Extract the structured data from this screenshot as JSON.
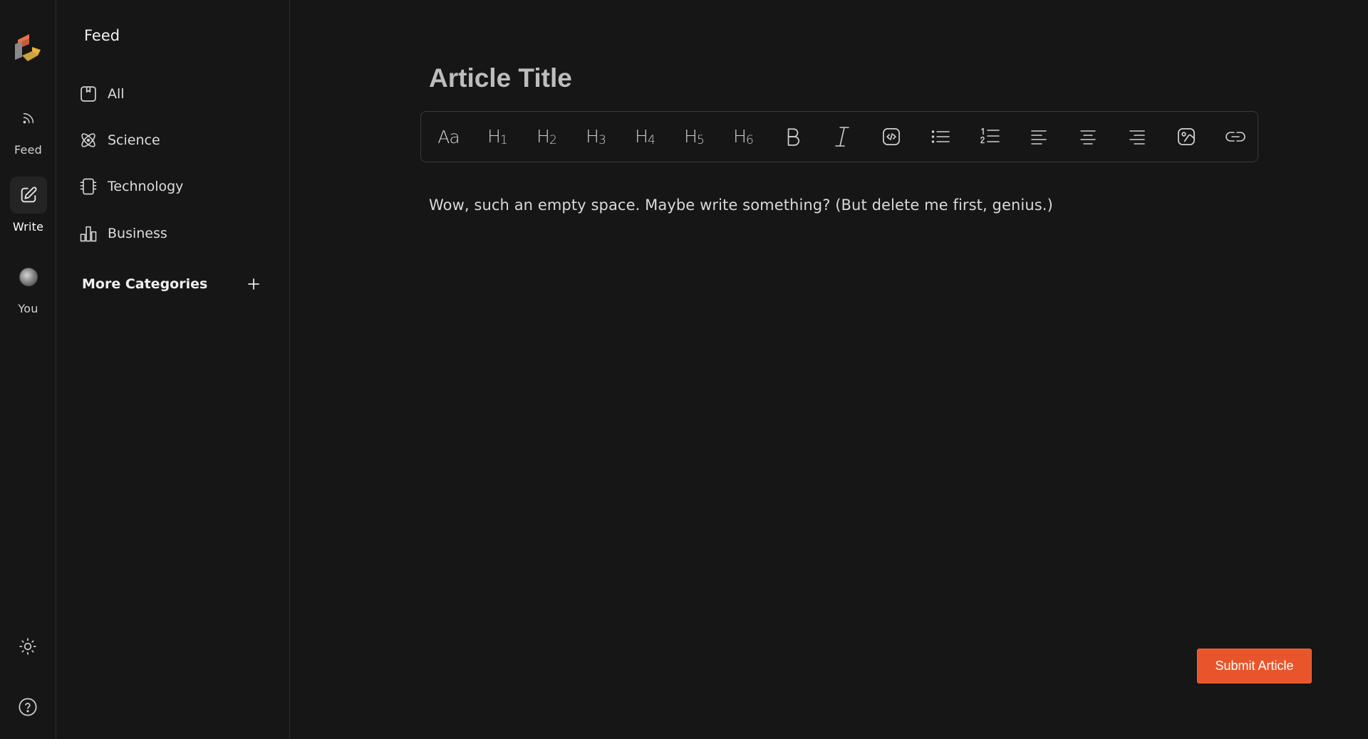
{
  "rail": {
    "logo_icon": "brand-logo-icon",
    "items": [
      {
        "label": "Feed",
        "icon": "rss-icon"
      },
      {
        "label": "Write",
        "icon": "edit-icon"
      },
      {
        "label": "You",
        "icon": "avatar"
      }
    ],
    "bottom": [
      {
        "icon": "sun-icon"
      },
      {
        "icon": "help-icon"
      }
    ]
  },
  "sidebar": {
    "title": "Feed",
    "categories": [
      {
        "label": "All",
        "icon": "bookmark-card-icon"
      },
      {
        "label": "Science",
        "icon": "atom-icon"
      },
      {
        "label": "Technology",
        "icon": "chip-icon"
      },
      {
        "label": "Business",
        "icon": "bar-chart-icon"
      }
    ],
    "more_label": "More Categories",
    "more_icon": "plus-icon"
  },
  "editor": {
    "title_placeholder": "Article Title",
    "toolbar": {
      "paragraph": "Aa",
      "h1": "H",
      "h1_sub": "1",
      "h2": "H",
      "h2_sub": "2",
      "h3": "H",
      "h3_sub": "3",
      "h4": "H",
      "h4_sub": "4",
      "h5": "H",
      "h5_sub": "5",
      "h6": "H",
      "h6_sub": "6"
    },
    "body_text": "Wow, such an empty space. Maybe write something? (But delete me first, genius.)",
    "submit_label": "Submit Article"
  },
  "colors": {
    "background": "#161616",
    "accent": "#e9552a",
    "border": "#2c2c2c"
  }
}
